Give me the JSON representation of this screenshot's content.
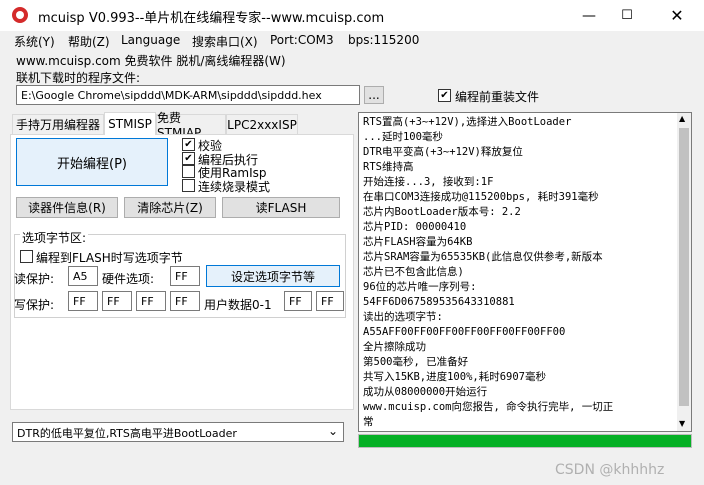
{
  "window": {
    "title": "mcuisp V0.993--单片机在线编程专家--www.mcuisp.com"
  },
  "menu": {
    "items": [
      "系统(Y)",
      "帮助(Z)",
      "Language",
      "搜索串口(X)",
      "Port:COM3",
      "bps:115200"
    ]
  },
  "links": {
    "text": "www.mcuisp.com 免费软件 脱机/离线编程器(W)"
  },
  "file": {
    "label": "联机下载时的程序文件:",
    "path": "E:\\Google Chrome\\sipddd\\MDK-ARM\\sipddd\\sipddd.hex",
    "browse": "...",
    "reload_label": "编程前重装文件",
    "reload_checked": true
  },
  "tabs": [
    "手持万用编程器",
    "STMISP",
    "免费STMIAP",
    "LPC2xxxISP"
  ],
  "stmisp": {
    "start_button": "开始编程(P)",
    "options": [
      {
        "label": "校验",
        "checked": true
      },
      {
        "label": "编程后执行",
        "checked": true
      },
      {
        "label": "使用RamIsp",
        "checked": false
      },
      {
        "label": "连续烧录模式",
        "checked": false
      }
    ],
    "read_info": "读器件信息(R)",
    "erase": "清除芯片(Z)",
    "read_flash": "读FLASH"
  },
  "option_bytes": {
    "group_title": "选项字节区:",
    "write_to_flash_label": "编程到FLASH时写选项字节",
    "write_to_flash_checked": false,
    "read_protect_label": "读保护:",
    "read_protect_value": "A5",
    "hw_option_label": "硬件选项:",
    "hw_option_value": "FF",
    "set_button": "设定选项字节等",
    "write_protect_label": "写保护:",
    "write_protect_values": [
      "FF",
      "FF",
      "FF",
      "FF"
    ],
    "user_data_label": "用户数据0-1",
    "user_data_values": [
      "FF",
      "FF"
    ]
  },
  "boot_mode": {
    "selected": "DTR的低电平复位,RTS高电平进BootLoader"
  },
  "log": {
    "lines": [
      "RTS置高(+3~+12V),选择进入BootLoader",
      "...延时100毫秒",
      "DTR电平变高(+3~+12V)释放复位",
      "RTS维持高",
      "开始连接...3, 接收到:1F",
      "在串口COM3连接成功@115200bps, 耗时391毫秒",
      "芯片内BootLoader版本号: 2.2",
      "芯片PID: 00000410",
      "芯片FLASH容量为64KB",
      "芯片SRAM容量为65535KB(此信息仅供参考,新版本",
      "芯片已不包含此信息)",
      "96位的芯片唯一序列号:",
      "54FF6D067589535643310881",
      "读出的选项字节:",
      "A55AFF00FF00FF00FF00FF00FF00FF00",
      "全片擦除成功",
      "第500毫秒, 已准备好",
      "共写入15KB,进度100%,耗时6907毫秒",
      "成功从08000000开始运行",
      "www.mcuisp.com向您报告, 命令执行完毕, 一切正",
      "常"
    ]
  },
  "progress": {
    "value": 1.0,
    "color": "#06b025"
  },
  "watermark": {
    "text": "CSDN @khhhhz"
  }
}
